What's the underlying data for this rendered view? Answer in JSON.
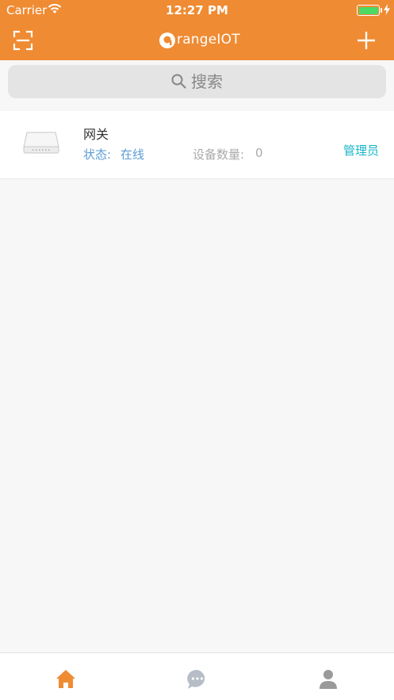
{
  "status_bar": {
    "carrier": "Carrier",
    "time": "12:27 PM",
    "battery_level": 1.0
  },
  "header": {
    "logo_text": "rangeIOT",
    "logo_letter": "o",
    "scan_icon": "scan-icon",
    "add_icon": "plus-icon"
  },
  "search": {
    "placeholder": "搜索",
    "icon": "search-icon"
  },
  "devices": [
    {
      "name": "网关",
      "state_label": "状态:",
      "state_value": "在线",
      "count_label": "设备数量:",
      "count_value": "0",
      "role": "管理员",
      "icon": "gateway-icon"
    }
  ],
  "tabbar": {
    "tabs": [
      {
        "name": "home",
        "icon": "home-icon",
        "active": true
      },
      {
        "name": "messages",
        "icon": "chat-icon",
        "active": false
      },
      {
        "name": "profile",
        "icon": "user-icon",
        "active": false
      }
    ]
  },
  "colors": {
    "brand": "#ef8b33",
    "link_blue": "#5b9bd5",
    "role_teal": "#17b5c8",
    "battery_green": "#4cd964"
  }
}
